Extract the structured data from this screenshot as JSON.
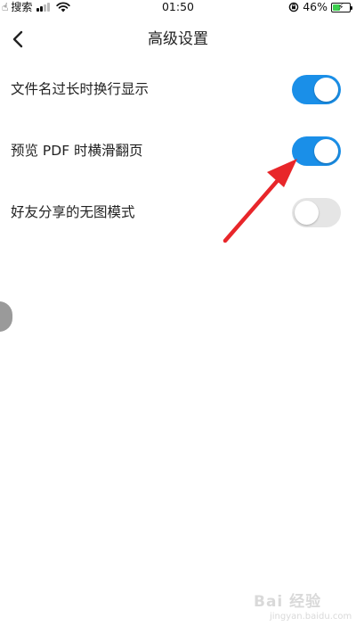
{
  "status_bar": {
    "carrier": "搜索",
    "time": "01:50",
    "battery_percent": "46%",
    "signal_level": 2,
    "signal_bars_total": 4,
    "battery_fraction": 0.46,
    "battery_color": "#3ccf4e",
    "charging": true
  },
  "nav": {
    "title": "高级设置",
    "back_icon": "chevron-left-icon"
  },
  "settings": [
    {
      "label": "文件名过长时换行显示",
      "enabled": true
    },
    {
      "label": "预览 PDF 时横滑翻页",
      "enabled": true
    },
    {
      "label": "好友分享的无图模式",
      "enabled": false
    }
  ],
  "colors": {
    "toggle_on": "#1a8fe8",
    "toggle_off": "#e5e5e5",
    "annotation_arrow": "#e8262a"
  },
  "watermark": {
    "main": "Bai 经验",
    "sub": "jingyan.baidu.com"
  }
}
